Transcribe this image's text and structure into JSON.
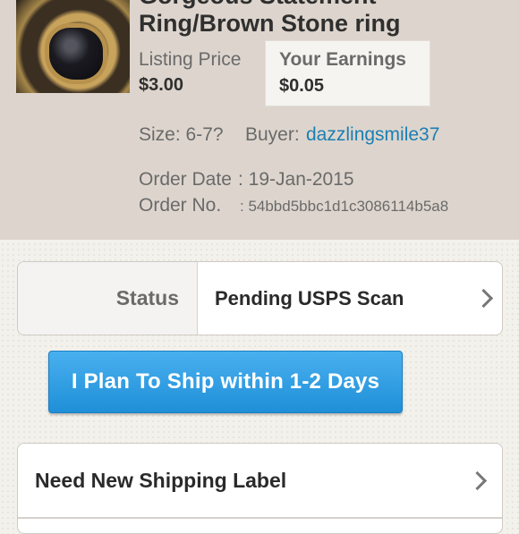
{
  "item": {
    "title_line1": "Gorgeous Statement",
    "title_line2": "Ring/Brown Stone ring",
    "listing_price_label": "Listing Price",
    "listing_price_value": "$3.00",
    "earnings_label": "Your Earnings",
    "earnings_value": "$0.05",
    "size_text": "Size: 6-7?",
    "buyer_label": "Buyer:",
    "buyer_name": "dazzlingsmile37",
    "order_date_label": "Order Date",
    "order_date_value": ": 19-Jan-2015",
    "order_no_label": "Order No.",
    "order_no_value": ": 54bbd5bbc1d1c3086114b5a8"
  },
  "status": {
    "label": "Status",
    "value": "Pending USPS Scan"
  },
  "actions": {
    "ship_button": "I Plan To Ship within 1-2 Days",
    "shipping_label_row": "Need New Shipping Label"
  },
  "colors": {
    "header_bg": "#ddd5cd",
    "link": "#1b7fb4",
    "button_blue": "#2a9be0"
  },
  "icons": [
    "chevron-right-icon",
    "chevron-right-icon"
  ]
}
